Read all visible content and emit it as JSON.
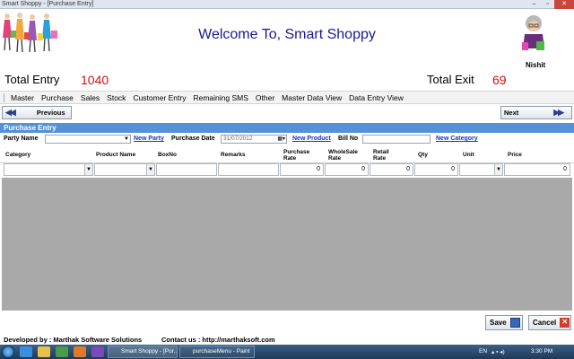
{
  "window": {
    "title": "Smart Shoppy - [Purchase Entry]"
  },
  "header": {
    "welcome": "Welcome To, Smart Shoppy",
    "username": "Nishit"
  },
  "stats": {
    "total_entry_label": "Total  Entry",
    "total_entry_value": "1040",
    "total_exit_label": "Total  Exit",
    "total_exit_value": "69"
  },
  "menu": [
    "Master",
    "Purchase",
    "Sales",
    "Stock",
    "Customer Entry",
    "Remaining SMS",
    "Other",
    "Master Data View",
    "Data Entry View"
  ],
  "nav": {
    "previous": "Previous",
    "next": "Next"
  },
  "section_title": "Purchase Entry",
  "form": {
    "party_name_label": "Party Name",
    "new_party": "New Party",
    "purchase_date_label": "Purchase Date",
    "purchase_date_value": "31/07/2012",
    "new_product": "New Product",
    "bill_no_label": "Bill No",
    "new_category": "New Category"
  },
  "grid": {
    "columns": [
      "Category",
      "Product Name",
      "BoxNo",
      "Remarks",
      "Purchase Rate",
      "WholeSale Rate",
      "Retail Rate",
      "Qty",
      "Unit",
      "Price"
    ],
    "row": {
      "purchase_rate": "0",
      "wholesale_rate": "0",
      "retail_rate": "0",
      "qty": "0",
      "price": "0"
    }
  },
  "actions": {
    "save": "Save",
    "cancel": "Cancel"
  },
  "footer": {
    "developer": "Developed by : Marthak Software Solutions",
    "contact": "Contact us : http://marthaksoft.com"
  },
  "taskbar": {
    "tasks": [
      "Smart Shoppy - [Pur...",
      "purchaseMenu - Paint"
    ],
    "lang": "EN",
    "time": "3:30 PM"
  }
}
